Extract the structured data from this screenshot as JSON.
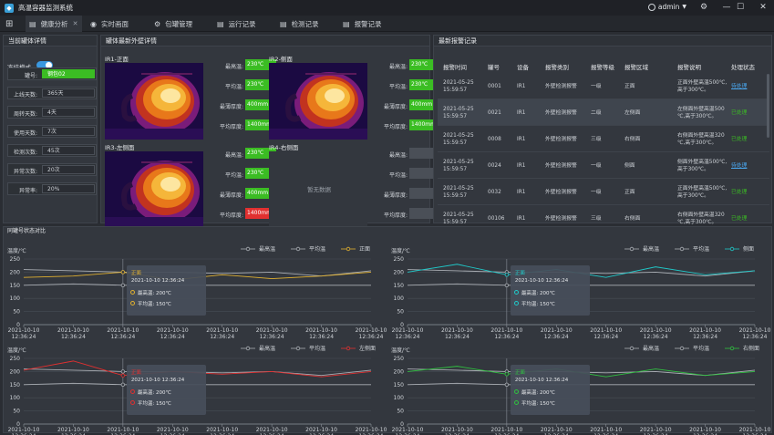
{
  "app": {
    "title": "高温容器监测系统",
    "user": "admin"
  },
  "window_controls": {
    "settings": "⚙",
    "min": "—",
    "max": "☐",
    "close": "✕"
  },
  "tabs": [
    {
      "label": "健康分析",
      "icon": "▤",
      "active": true,
      "closable": true
    },
    {
      "label": "实时画面",
      "icon": "◉"
    },
    {
      "label": "包罐管理",
      "icon": "⚙"
    },
    {
      "label": "运行记录",
      "icon": "▤"
    },
    {
      "label": "检测记录",
      "icon": "▤"
    },
    {
      "label": "报警记录",
      "icon": "▤"
    }
  ],
  "detail": {
    "title": "当前罐体详情",
    "mode_label": "冻结模式",
    "mode_on": true,
    "rows": [
      {
        "label": "罐号:",
        "value": "钢包02",
        "highlight": true
      },
      {
        "label": "上线天数:",
        "value": "365天"
      },
      {
        "label": "周转天数:",
        "value": "4天"
      },
      {
        "label": "使用天数:",
        "value": "7次"
      },
      {
        "label": "检测次数:",
        "value": "45次"
      },
      {
        "label": "异常次数:",
        "value": "20次"
      },
      {
        "label": "异常率:",
        "value": "20%"
      }
    ]
  },
  "thermal": {
    "title": "罐体最新外壁详情",
    "metric_labels": [
      "最高温:",
      "平均温:",
      "最薄厚度:",
      "平均厚度:"
    ],
    "cams": [
      {
        "name": "IR1-正面",
        "has_data": true,
        "values": [
          "230℃",
          "230℃",
          "400mm",
          "1400mm"
        ],
        "alert": [
          false,
          false,
          false,
          false
        ]
      },
      {
        "name": "IR2-侧面",
        "has_data": true,
        "values": [
          "230℃",
          "230℃",
          "400mm",
          "1400mm"
        ],
        "alert": [
          false,
          false,
          false,
          false
        ]
      },
      {
        "name": "IR3-左侧面",
        "has_data": true,
        "values": [
          "230℃",
          "230℃",
          "400mm",
          "1400mm"
        ],
        "alert": [
          false,
          false,
          false,
          true
        ]
      },
      {
        "name": "IR4-右侧面",
        "has_data": false,
        "values": [
          "",
          "",
          "",
          ""
        ],
        "alert": [
          false,
          false,
          false,
          false
        ],
        "empty_text": "暂无数据"
      }
    ]
  },
  "alarms": {
    "title": "最新报警记录",
    "headers": [
      "报警时间",
      "罐号",
      "设备",
      "报警类别",
      "报警等级",
      "报警区域",
      "报警说明",
      "处理状态"
    ],
    "rows": [
      {
        "time": [
          "2021-05-25",
          "15:59:57"
        ],
        "tank": "0001",
        "device": "IR1",
        "category": "外壁检测报警",
        "level": "一级",
        "area": "正面",
        "desc": [
          "正面外壁高温500℃,",
          "高于300℃。"
        ],
        "status": "待处理",
        "state": "pending"
      },
      {
        "time": [
          "2021-05-25",
          "15:59:57"
        ],
        "tank": "0021",
        "device": "IR1",
        "category": "外壁检测报警",
        "level": "二级",
        "area": "左侧面",
        "desc": [
          "左侧面外壁高温500",
          "℃,高于300℃。"
        ],
        "status": "已处理",
        "state": "done",
        "selected": true
      },
      {
        "time": [
          "2021-05-25",
          "15:59:57"
        ],
        "tank": "0008",
        "device": "IR1",
        "category": "外壁检测报警",
        "level": "三级",
        "area": "右侧面",
        "desc": [
          "右侧面外壁高温320",
          "℃,高于300℃。"
        ],
        "status": "已处理",
        "state": "done"
      },
      {
        "time": [
          "2021-05-25",
          "15:59:57"
        ],
        "tank": "0024",
        "device": "IR1",
        "category": "外壁检测报警",
        "level": "一级",
        "area": "侧面",
        "desc": [
          "侧面外壁高温500℃,",
          "高于300℃。"
        ],
        "status": "待处理",
        "state": "pending"
      },
      {
        "time": [
          "2021-05-25",
          "15:59:57"
        ],
        "tank": "0032",
        "device": "IR1",
        "category": "外壁检测报警",
        "level": "一级",
        "area": "正面",
        "desc": [
          "正面外壁高温500℃,",
          "高于300℃。"
        ],
        "status": "已处理",
        "state": "done"
      },
      {
        "time": [
          "2021-05-25",
          "15:59:57"
        ],
        "tank": "00106",
        "device": "IR1",
        "category": "外壁检测报警",
        "level": "三级",
        "area": "右侧面",
        "desc": [
          "右侧面外壁高温320",
          "℃,高于300℃。"
        ],
        "status": "已处理",
        "state": "done"
      }
    ]
  },
  "trend": {
    "title": "同罐号状态对比",
    "tooltip_date": "2021-10-10  12:36:24",
    "legend_max": "最高温",
    "legend_avg": "平均温"
  },
  "chart_data": [
    {
      "type": "line",
      "ylabel": "温度/℃",
      "ylim": [
        0,
        250
      ],
      "yticks": [
        0,
        50,
        100,
        150,
        200,
        250
      ],
      "x": [
        [
          "2021-10-10",
          "12:36:24"
        ],
        [
          "2021-10-10",
          "12:36:24"
        ],
        [
          "2021-10-10",
          "12:36:24"
        ],
        [
          "2021-10-10",
          "12:36:24"
        ],
        [
          "2021-10-10",
          "12:36:24"
        ],
        [
          "2021-10-10",
          "12:36:24"
        ],
        [
          "2021-10-10",
          "12:36:24"
        ],
        [
          "2021-10-10",
          "12:36:24"
        ]
      ],
      "series": [
        {
          "name": "最高温",
          "color": "#a9adb3",
          "values": [
            210,
            205,
            200,
            200,
            195,
            200,
            185,
            205
          ]
        },
        {
          "name": "平均温",
          "color": "#a9adb3",
          "values": [
            150,
            155,
            150,
            150,
            150,
            150,
            150,
            150
          ]
        },
        {
          "name": "正面",
          "color": "#e0b030",
          "values": [
            180,
            185,
            200,
            170,
            190,
            175,
            185,
            200
          ]
        }
      ],
      "tooltip": {
        "title": "正面",
        "max": "最高温:   200℃",
        "avg": "平均温:   150℃"
      }
    },
    {
      "type": "line",
      "ylabel": "温度/℃",
      "ylim": [
        0,
        250
      ],
      "yticks": [
        0,
        50,
        100,
        150,
        200,
        250
      ],
      "x": [
        [
          "2021-10-10",
          "12:36:24"
        ],
        [
          "2021-10-10",
          "12:36:24"
        ],
        [
          "2021-10-10",
          "12:36:24"
        ],
        [
          "2021-10-10",
          "12:36:24"
        ],
        [
          "2021-10-10",
          "12:36:24"
        ],
        [
          "2021-10-10",
          "12:36:24"
        ],
        [
          "2021-10-10",
          "12:36:24"
        ],
        [
          "2021-10-10",
          "12:36:24"
        ]
      ],
      "series": [
        {
          "name": "最高温",
          "color": "#a9adb3",
          "values": [
            210,
            205,
            200,
            200,
            195,
            200,
            185,
            205
          ]
        },
        {
          "name": "平均温",
          "color": "#a9adb3",
          "values": [
            150,
            155,
            150,
            150,
            150,
            150,
            150,
            150
          ]
        },
        {
          "name": "侧面",
          "color": "#20c8c8",
          "values": [
            200,
            230,
            190,
            210,
            180,
            220,
            190,
            205
          ]
        }
      ],
      "tooltip": {
        "title": "正面",
        "max": "最高温:   200℃",
        "avg": "平均温:   150℃"
      }
    },
    {
      "type": "line",
      "ylabel": "温度/℃",
      "ylim": [
        0,
        250
      ],
      "yticks": [
        0,
        50,
        100,
        150,
        200,
        250
      ],
      "x": [
        [
          "2021-10-10",
          "12:36:24"
        ],
        [
          "2021-10-10",
          "12:36:24"
        ],
        [
          "2021-10-10",
          "12:36:24"
        ],
        [
          "2021-10-10",
          "12:36:24"
        ],
        [
          "2021-10-10",
          "12:36:24"
        ],
        [
          "2021-10-10",
          "12:36:24"
        ],
        [
          "2021-10-10",
          "12:36:24"
        ],
        [
          "2021-10-10",
          "12:36:24"
        ]
      ],
      "series": [
        {
          "name": "最高温",
          "color": "#a9adb3",
          "values": [
            210,
            205,
            200,
            200,
            195,
            200,
            185,
            205
          ]
        },
        {
          "name": "平均温",
          "color": "#a9adb3",
          "values": [
            150,
            155,
            150,
            150,
            150,
            150,
            150,
            150
          ]
        },
        {
          "name": "左侧面",
          "color": "#e03030",
          "values": [
            205,
            240,
            185,
            200,
            190,
            200,
            180,
            200
          ]
        }
      ],
      "tooltip": {
        "title": "正面",
        "max": "最高温:   200℃",
        "avg": "平均温:   150℃"
      }
    },
    {
      "type": "line",
      "ylabel": "温度/℃",
      "ylim": [
        0,
        250
      ],
      "yticks": [
        0,
        50,
        100,
        150,
        200,
        250
      ],
      "x": [
        [
          "2021-10-10",
          "12:36:24"
        ],
        [
          "2021-10-10",
          "12:36:24"
        ],
        [
          "2021-10-10",
          "12:36:24"
        ],
        [
          "2021-10-10",
          "12:36:24"
        ],
        [
          "2021-10-10",
          "12:36:24"
        ],
        [
          "2021-10-10",
          "12:36:24"
        ],
        [
          "2021-10-10",
          "12:36:24"
        ],
        [
          "2021-10-10",
          "12:36:24"
        ]
      ],
      "series": [
        {
          "name": "最高温",
          "color": "#a9adb3",
          "values": [
            210,
            205,
            200,
            200,
            195,
            200,
            185,
            205
          ]
        },
        {
          "name": "平均温",
          "color": "#a9adb3",
          "values": [
            150,
            155,
            150,
            150,
            150,
            150,
            150,
            150
          ]
        },
        {
          "name": "右侧面",
          "color": "#30c040",
          "values": [
            200,
            220,
            190,
            210,
            180,
            210,
            185,
            200
          ]
        }
      ],
      "tooltip": {
        "title": "正面",
        "max": "最高温:   200℃",
        "avg": "平均温:   150℃"
      }
    }
  ]
}
